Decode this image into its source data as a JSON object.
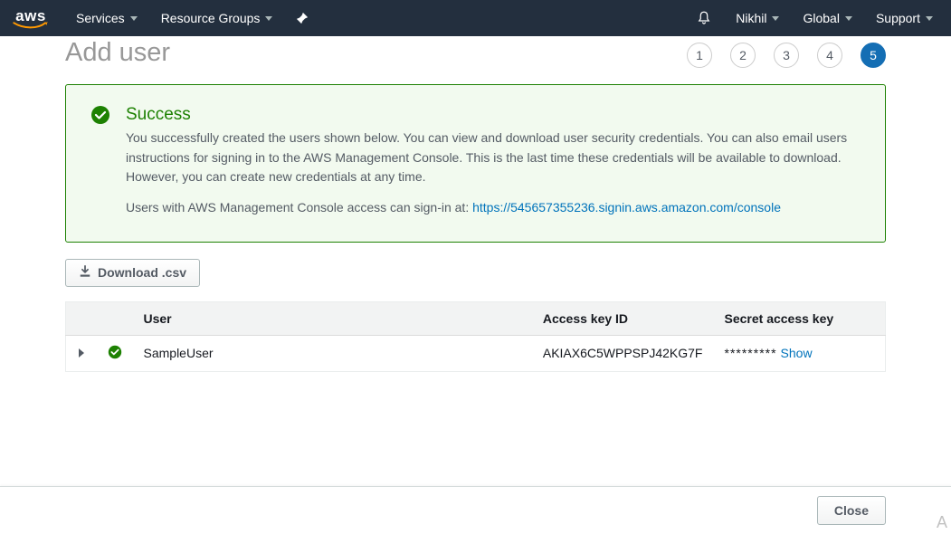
{
  "nav": {
    "logo_text": "aws",
    "services": "Services",
    "resource_groups": "Resource Groups",
    "user": "Nikhil",
    "region": "Global",
    "support": "Support"
  },
  "page": {
    "title": "Add user"
  },
  "wizard": {
    "steps": [
      "1",
      "2",
      "3",
      "4",
      "5"
    ],
    "active_index": 4
  },
  "alert": {
    "title": "Success",
    "body1": "You successfully created the users shown below. You can view and download user security credentials. You can also email users instructions for signing in to the AWS Management Console. This is the last time these credentials will be available to download. However, you can create new credentials at any time.",
    "body2_prefix": "Users with AWS Management Console access can sign-in at: ",
    "signin_url": "https://545657355236.signin.aws.amazon.com/console"
  },
  "buttons": {
    "download_csv": "Download .csv",
    "close": "Close",
    "show": "Show"
  },
  "table": {
    "headers": {
      "user": "User",
      "access_key": "Access key ID",
      "secret": "Secret access key"
    },
    "rows": [
      {
        "username": "SampleUser",
        "access_key_id": "AKIAX6C5WPPSPJ42KG7F",
        "secret_masked": "*********"
      }
    ]
  }
}
